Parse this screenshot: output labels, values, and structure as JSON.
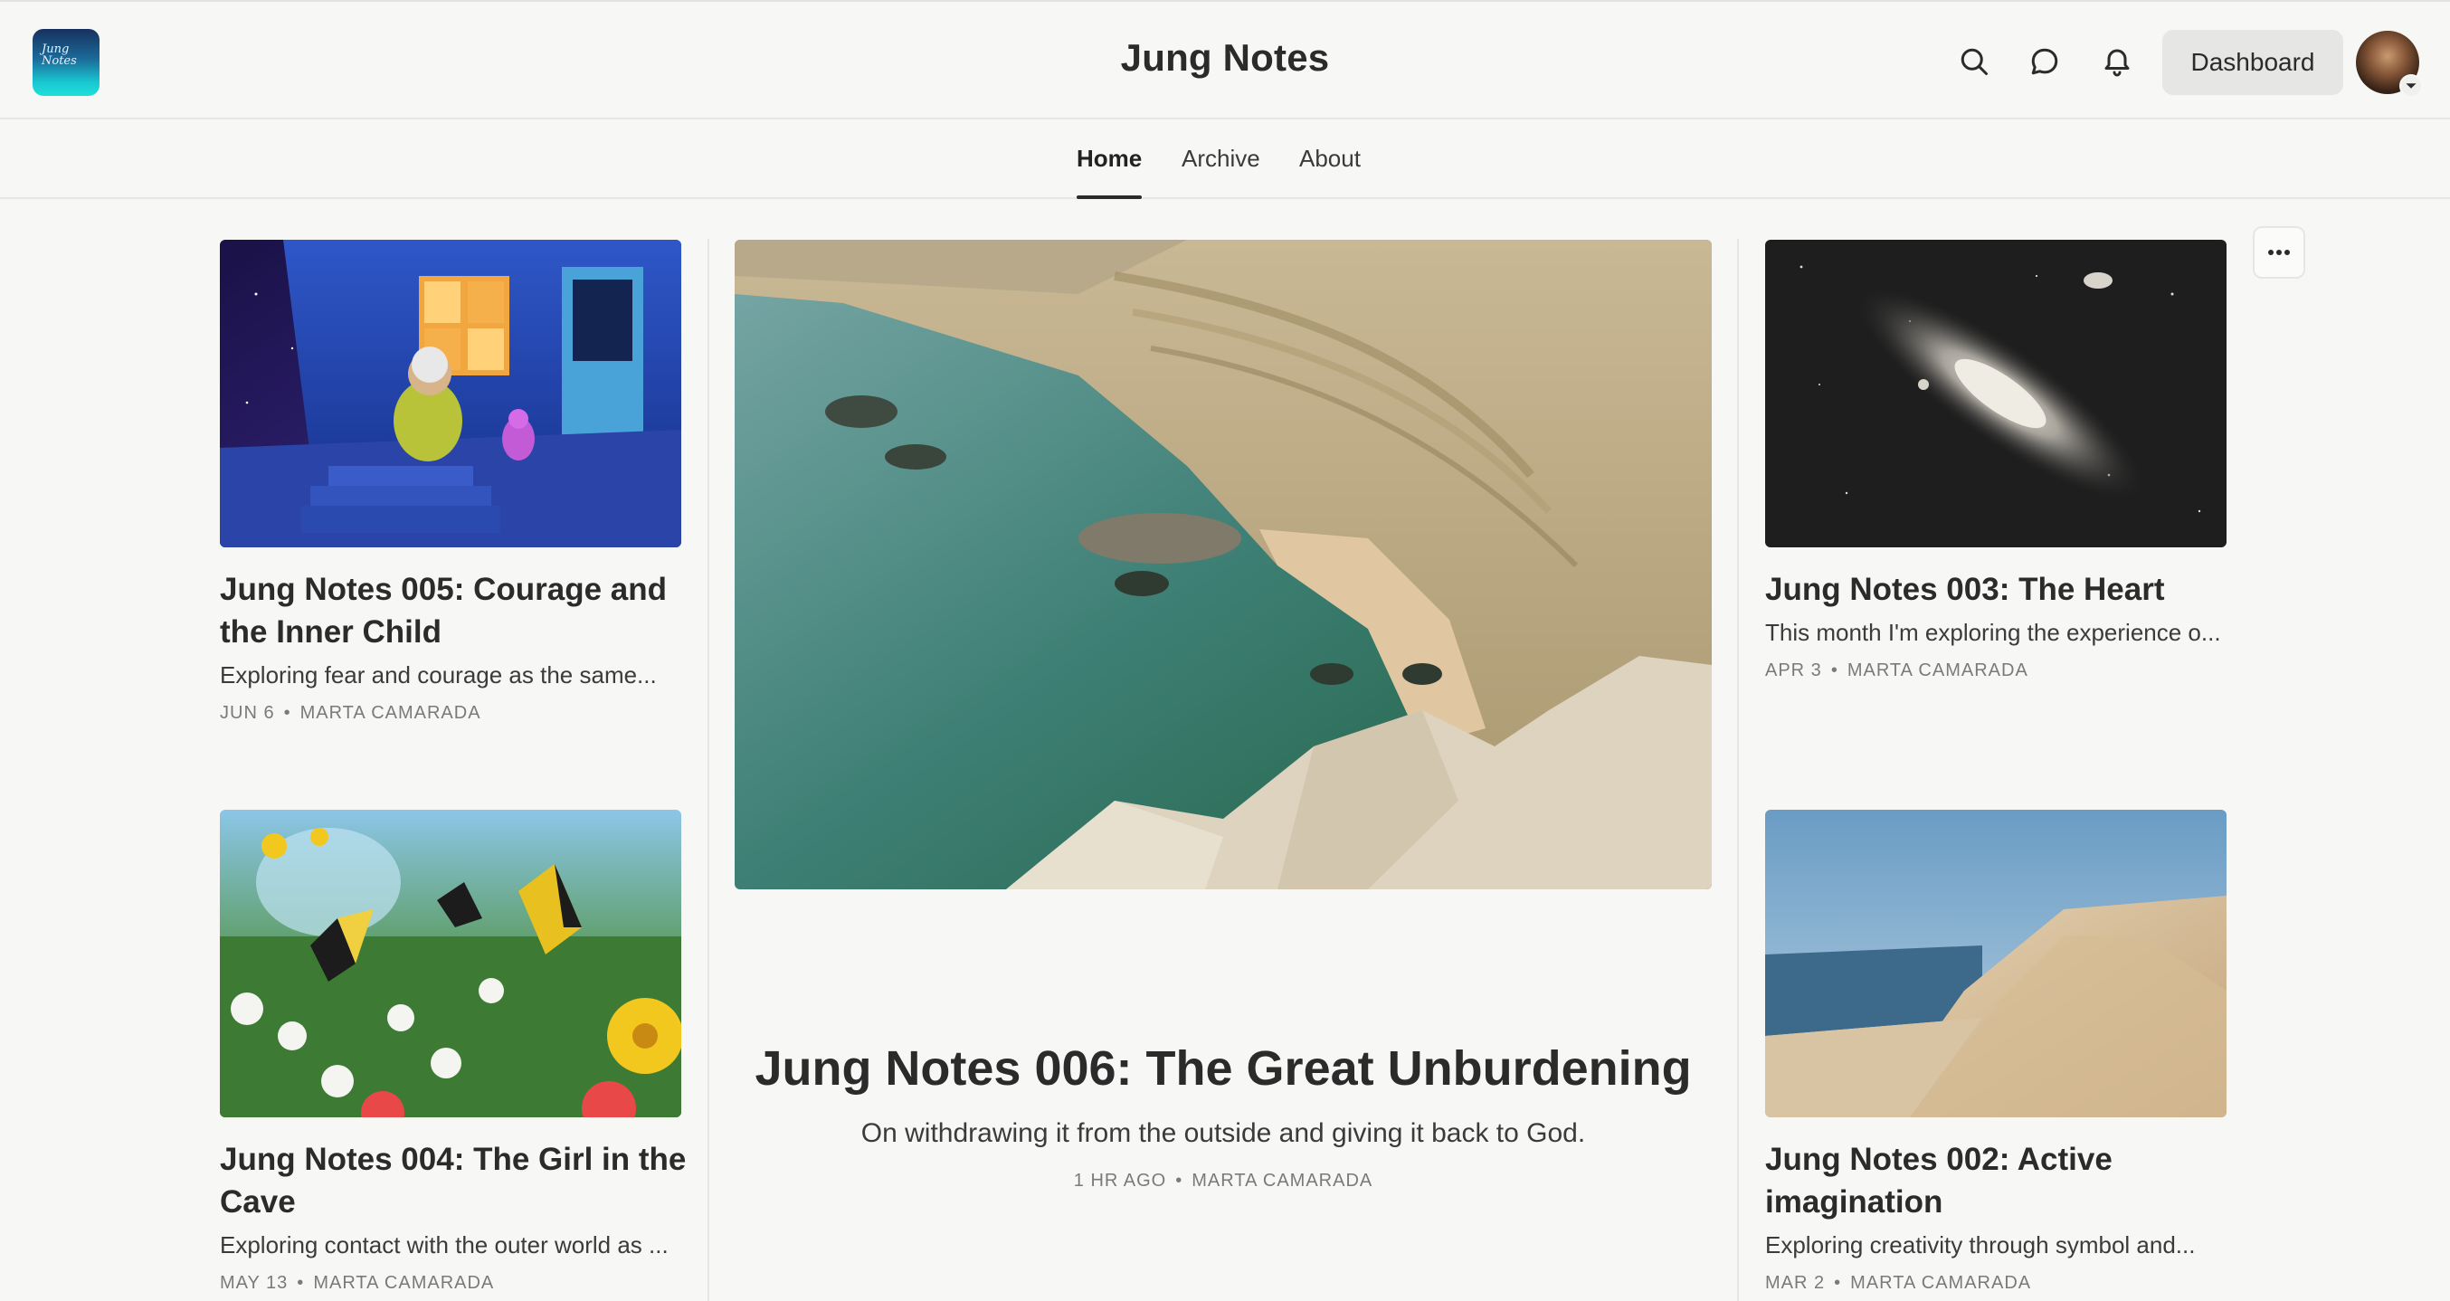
{
  "header": {
    "logo_text": "Jung Notes",
    "site_title": "Jung Notes",
    "dashboard_label": "Dashboard",
    "icons": [
      "search-icon",
      "chat-icon",
      "bell-icon",
      "chevron-down-icon"
    ]
  },
  "nav": {
    "tabs": [
      {
        "label": "Home",
        "active": true
      },
      {
        "label": "Archive",
        "active": false
      },
      {
        "label": "About",
        "active": false
      }
    ]
  },
  "posts": {
    "p005": {
      "title": "Jung Notes 005: Courage and the Inner Child",
      "subtitle": "Exploring fear and courage as the same...",
      "date": "JUN 6",
      "author": "MARTA CAMARADA"
    },
    "p004": {
      "title": "Jung Notes 004: The Girl in the Cave",
      "subtitle": "Exploring contact with the outer world as ...",
      "date": "MAY 13",
      "author": "MARTA CAMARADA"
    },
    "p003": {
      "title": "Jung Notes 003: The Heart",
      "subtitle": "This month I'm exploring the experience o...",
      "date": "APR 3",
      "author": "MARTA CAMARADA"
    },
    "p002": {
      "title": "Jung Notes 002: Active imagination",
      "subtitle": "Exploring creativity through symbol and...",
      "date": "MAR 2",
      "author": "MARTA CAMARADA"
    },
    "featured": {
      "title": "Jung Notes 006: The Great Unburdening",
      "subtitle": "On withdrawing it from the outside and giving it back to God.",
      "date": "1 HR AGO",
      "author": "MARTA CAMARADA"
    }
  },
  "meta_separator": "•",
  "colors": {
    "background": "#f7f7f5",
    "text": "#2b2b2b",
    "muted": "#7a7a7a",
    "divider": "#e6e6e4"
  }
}
